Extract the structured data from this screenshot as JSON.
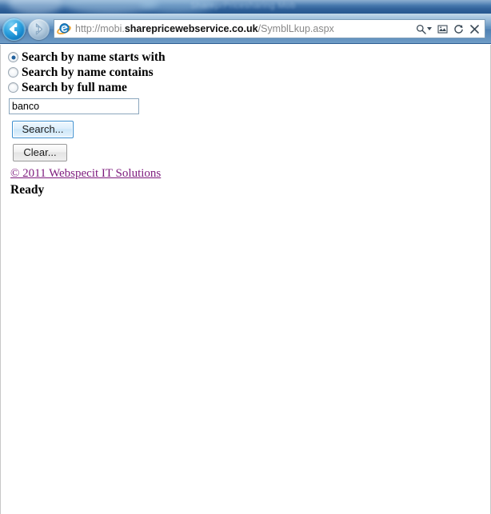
{
  "window": {
    "title_ghost": "ShareprPricesharing  Mob"
  },
  "browser": {
    "back_label": "Back",
    "forward_label": "Forward",
    "address": {
      "scheme_prefix": "http://mobi.",
      "host": "sharepricewebservice.co.uk",
      "path": "/SymblLkup.aspx",
      "full_url": "http://mobi.sharepricewebservice.co.uk/SymblLkup.aspx"
    },
    "tools": {
      "search_icon": "search-icon",
      "dropdown_icon": "chevron-down-icon",
      "compatibility_icon": "compatibility-view-icon",
      "refresh_icon": "refresh-icon",
      "stop_icon": "stop-close-icon"
    }
  },
  "page": {
    "search_options": [
      {
        "label": "Search by name starts with",
        "selected": true
      },
      {
        "label": "Search by name contains",
        "selected": false
      },
      {
        "label": "Search by full name",
        "selected": false
      }
    ],
    "search_field": {
      "value": "banco",
      "placeholder": ""
    },
    "buttons": {
      "search": "Search...",
      "clear": "Clear..."
    },
    "footer_link": "© 2011 Webspecit IT Solutions",
    "status": "Ready"
  },
  "colors": {
    "title_bar": "#2f6099",
    "nav_bar": "#5f8fbe",
    "back_button": "#0d7cc4",
    "link_purple": "#7d1a7d",
    "radio_dot": "#20609c",
    "search_button_border": "#3c8fd0"
  }
}
